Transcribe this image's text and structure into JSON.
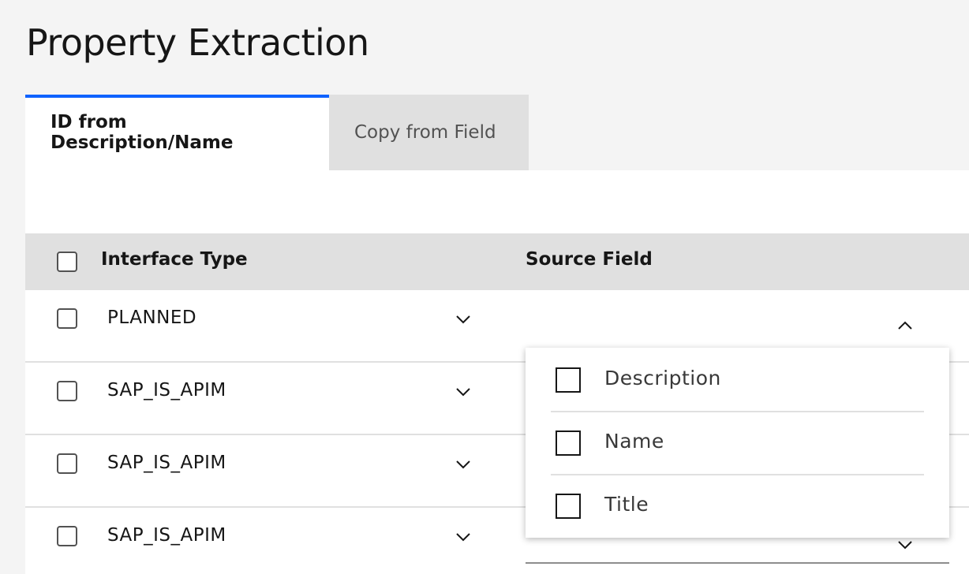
{
  "page": {
    "title": "Property Extraction"
  },
  "tabs": [
    {
      "label": "ID from Description/Name",
      "selected": true
    },
    {
      "label": "Copy from Field",
      "selected": false
    }
  ],
  "table": {
    "headers": {
      "interface_type": "Interface Type",
      "source_field": "Source Field"
    },
    "rows": [
      {
        "interface_type": "PLANNED"
      },
      {
        "interface_type": "SAP_IS_APIM"
      },
      {
        "interface_type": "SAP_IS_APIM"
      },
      {
        "interface_type": "SAP_IS_APIM"
      }
    ]
  },
  "source_field_menu": {
    "options": [
      {
        "label": "Description",
        "checked": false
      },
      {
        "label": "Name",
        "checked": false
      },
      {
        "label": "Title",
        "checked": false
      }
    ]
  },
  "colors": {
    "accent": "#0f62fe",
    "background": "#f4f4f4",
    "header_bg": "#e0e0e0",
    "text": "#161616"
  },
  "icons": {
    "row_dropdown": "chevron-down-icon",
    "open_dropdown": "chevron-up-icon"
  }
}
